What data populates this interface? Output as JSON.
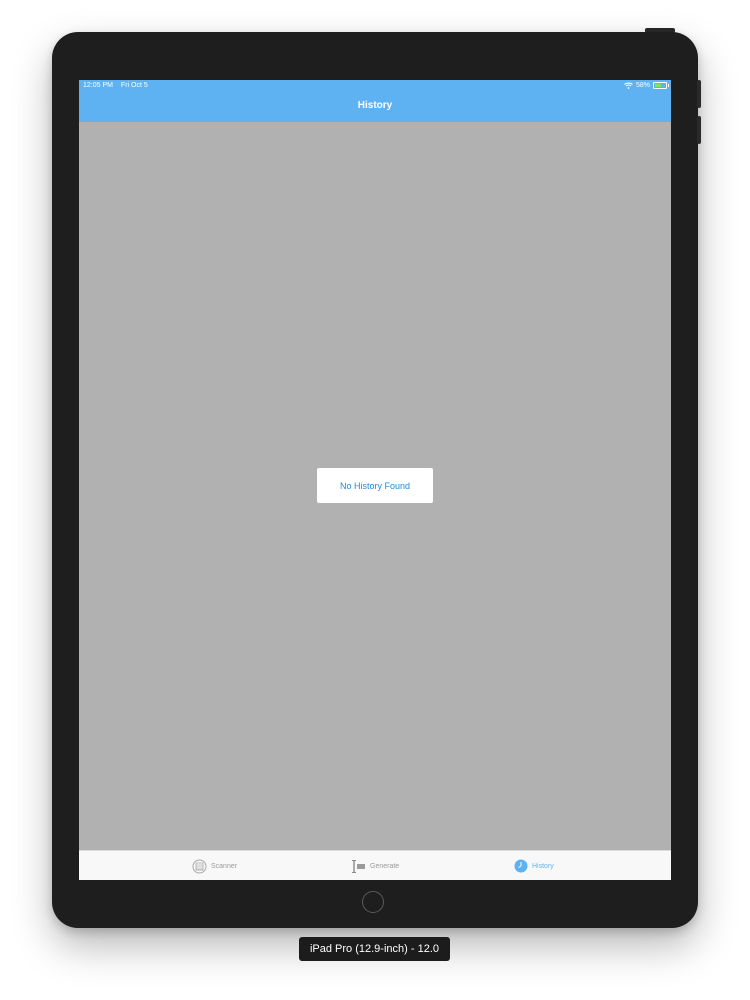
{
  "status_bar": {
    "time": "12:05 PM",
    "date": "Fri Oct 5",
    "battery_text": "58%",
    "battery_level": 0.58,
    "wifi_icon": "wifi-icon"
  },
  "nav": {
    "title": "History"
  },
  "main": {
    "empty_message": "No History Found"
  },
  "tabbar": {
    "tabs": [
      {
        "label": "Scanner",
        "icon": "scanner-icon",
        "active": false
      },
      {
        "label": "Generate",
        "icon": "generate-icon",
        "active": false
      },
      {
        "label": "History",
        "icon": "clock-icon",
        "active": true
      }
    ]
  },
  "device": {
    "label": "iPad Pro (12.9-inch) - 12.0"
  },
  "colors": {
    "nav_blue": "#5fb2f2",
    "content_gray": "#b2b1b2",
    "message_blue": "#1a8be0",
    "bezel": "#1e1e1f"
  }
}
